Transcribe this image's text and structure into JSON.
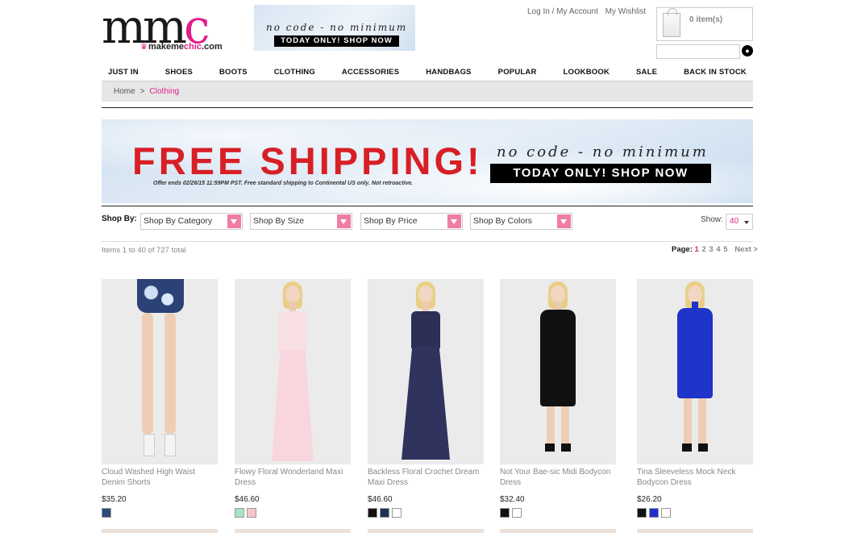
{
  "logo": {
    "mark": "mm",
    "mark_c": "c",
    "site": "makeme",
    "site_pink": "chic",
    "site_end": ".com"
  },
  "top_banner": {
    "tagline": "no code - no minimum",
    "cta": "TODAY ONLY! SHOP NOW"
  },
  "account": {
    "login": "Log In / My Account",
    "wishlist": "My Wishlist"
  },
  "cart": {
    "count": "0 item(s)"
  },
  "search": {
    "placeholder": ""
  },
  "nav": [
    "JUST IN",
    "SHOES",
    "BOOTS",
    "CLOTHING",
    "ACCESSORIES",
    "HANDBAGS",
    "POPULAR",
    "LOOKBOOK",
    "SALE",
    "BACK IN STOCK"
  ],
  "breadcrumb": {
    "home": "Home",
    "sep": ">",
    "current": "Clothing"
  },
  "hero": {
    "title": "FREE SHIPPING!",
    "fine_print": "Offer ends 02/26/15 11:59PM PST. Free standard shipping to Continental US only. Not retroactive.",
    "tagline": "no code - no minimum",
    "cta": "TODAY ONLY! SHOP NOW"
  },
  "filters": {
    "label": "Shop By:",
    "category": "Shop By Category",
    "size": "Shop By Size",
    "price": "Shop By Price",
    "colors": "Shop By Colors",
    "show_label": "Show:",
    "show_value": "40"
  },
  "results": {
    "count": "Items 1 to 40 of 727 total"
  },
  "pager": {
    "label": "Page:",
    "pages": [
      "1",
      "2",
      "3",
      "4",
      "5"
    ],
    "next": "Next >"
  },
  "products": [
    {
      "name": "Cloud Washed High Waist Denim Shorts",
      "price": "$35.20",
      "swatches": [
        "#2f4a7a"
      ]
    },
    {
      "name": "Flowy Floral Wonderland Maxi Dress",
      "price": "$46.60",
      "swatches": [
        "#a8e3c4",
        "#f6c6cf"
      ]
    },
    {
      "name": "Backless Floral Crochet Dream Maxi Dress",
      "price": "$46.60",
      "swatches": [
        "#111111",
        "#1f2f5a",
        "#ffffff"
      ]
    },
    {
      "name": "Not Your Bae-sic Midi Bodycon Dress",
      "price": "$32.40",
      "swatches": [
        "#111111",
        "#ffffff"
      ]
    },
    {
      "name": "Tina Sleeveless Mock Neck Bodycon Dress",
      "price": "$26.20",
      "swatches": [
        "#111111",
        "#1f2fc9",
        "#ffffff"
      ]
    }
  ]
}
